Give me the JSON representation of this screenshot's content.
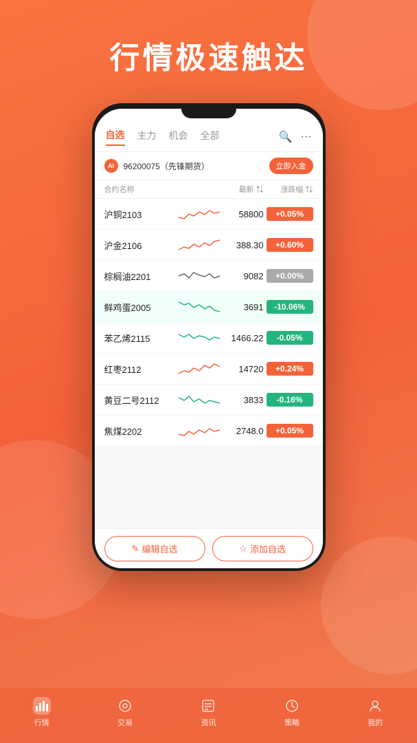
{
  "header": {
    "title": "行情极速触达"
  },
  "tabs": [
    {
      "label": "自选",
      "active": true
    },
    {
      "label": "主力",
      "active": false
    },
    {
      "label": "机会",
      "active": false
    },
    {
      "label": "全部",
      "active": false
    }
  ],
  "banner": {
    "logo_text": "Ai",
    "text": "96200075（先锋期货）",
    "button": "立即入金"
  },
  "columns": {
    "name": "合约名称",
    "price": "最新 ⇅",
    "change": "涨跌幅 ⇅"
  },
  "stocks": [
    {
      "name": "沪铜2103",
      "price": "58800",
      "change": "+0.05%",
      "type": "red",
      "chart": "red"
    },
    {
      "name": "沪金2106",
      "price": "388.30",
      "change": "+0.60%",
      "type": "red",
      "chart": "red"
    },
    {
      "name": "棕榈油2201",
      "price": "9082",
      "change": "+0.00%",
      "type": "gray",
      "chart": "gray"
    },
    {
      "name": "鲜鸡蛋2005",
      "price": "3691",
      "change": "-10.06%",
      "type": "green",
      "chart": "green"
    },
    {
      "name": "苯乙烯2115",
      "price": "1466.22",
      "change": "-0.05%",
      "type": "green",
      "chart": "green"
    },
    {
      "name": "红枣2112",
      "price": "14720",
      "change": "+0.24%",
      "type": "red",
      "chart": "red"
    },
    {
      "name": "黄豆二号2112",
      "price": "3833",
      "change": "-0.16%",
      "type": "green",
      "chart": "green"
    },
    {
      "name": "焦煤2202",
      "price": "2748.0",
      "change": "+0.05%",
      "type": "red",
      "chart": "red"
    }
  ],
  "bottom_buttons": [
    {
      "label": "编辑自选",
      "icon": "✎"
    },
    {
      "label": "添加自选",
      "icon": "☆"
    }
  ],
  "nav": [
    {
      "label": "行情",
      "icon": "📊",
      "active": true
    },
    {
      "label": "交易",
      "icon": "◎",
      "active": false
    },
    {
      "label": "资讯",
      "icon": "▦",
      "active": false
    },
    {
      "label": "策略",
      "icon": "◷",
      "active": false
    },
    {
      "label": "我的",
      "icon": "☺",
      "active": false
    }
  ]
}
